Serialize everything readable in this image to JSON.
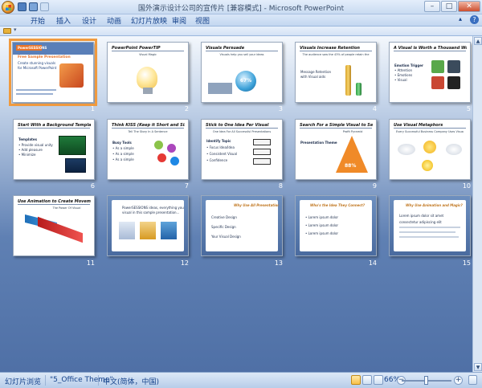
{
  "window": {
    "title": "国外演示设计公司的宣传片 [兼容模式] - Microsoft PowerPoint",
    "controls": [
      "–",
      "□",
      "✕"
    ]
  },
  "ribbon": {
    "tabs": [
      "开始",
      "插入",
      "设计",
      "动画",
      "幻灯片放映",
      "审阅",
      "视图"
    ]
  },
  "slides": [
    {
      "num": "1",
      "title": "PowerSESSIONS",
      "lines": [
        "Free Sample Presentation",
        "Create stunning visuals",
        "for Microsoft PowerPoint"
      ]
    },
    {
      "num": "2",
      "title": "PowerPoint PowerTIP",
      "sub": "Visual Magic",
      "lines": []
    },
    {
      "num": "3",
      "title": "Visuals Persuade",
      "sub": "Visuals help you sell your ideas",
      "lines": [
        "67%"
      ]
    },
    {
      "num": "4",
      "title": "Visuals Increase Retention",
      "sub": "The audience saw the 43% of people retain the",
      "lines": [
        "Message Retention",
        "with Visual aids"
      ]
    },
    {
      "num": "5",
      "title": "A Visual is Worth a Thousand Words",
      "lines": [
        "Emotion Trigger",
        "• Attention",
        "• Emotions",
        "• Visual"
      ]
    },
    {
      "num": "6",
      "title": "Start With a Background Template",
      "lines": [
        "Templates",
        "• Provide visual unity",
        "• Add pleasure",
        "• Minimize"
      ]
    },
    {
      "num": "7",
      "title": "Think KISS (Keep it Short and Simple)",
      "sub": "Tell The Story In A Sentence",
      "lines": [
        "Busy Tools",
        "• As a simple",
        "• As a simple",
        "• As a simple"
      ]
    },
    {
      "num": "8",
      "title": "Stick to One Idea Per Visual",
      "sub": "One Idea For All Successful Presentations",
      "lines": [
        "Identify Topic",
        "• Focus Idea/Idea",
        "• Consistent Visual",
        "• Confidence"
      ]
    },
    {
      "num": "9",
      "title": "Search For a Simple Visual to Sell your Message",
      "sub": "Profit Pyramid",
      "lines": [
        "Presentation Theme",
        "88%"
      ]
    },
    {
      "num": "10",
      "title": "Use Visual Metaphors",
      "sub": "Every Successful Business Company Uses Visual Metaphors",
      "lines": []
    },
    {
      "num": "11",
      "title": "Use Animation to Create Movement",
      "sub": "The Power Of Visual",
      "lines": []
    },
    {
      "num": "12",
      "title": "",
      "lines": [
        "PowerSESSIONS ideas, everything you",
        "visual in this sample presentation..."
      ]
    },
    {
      "num": "13",
      "title": "Why Use All Presentations?",
      "lines": [
        "Creative Design",
        "Specific Design",
        "Your Visual Design"
      ]
    },
    {
      "num": "14",
      "title": "Who's the Idea They Connect?",
      "lines": [
        "• Lorem ipsum dolor",
        "• Lorem ipsum dolor",
        "• Lorem ipsum dolor"
      ]
    },
    {
      "num": "15",
      "title": "Why Use Animation and Magic?",
      "lines": [
        "Lorem ipsum dolor sit amet",
        "consectetur adipiscing elit"
      ]
    }
  ],
  "statusbar": {
    "view": "幻灯片浏览",
    "theme": "\"5_Office Theme\"",
    "language": "中文(简体，中国)",
    "zoom": "66%",
    "zoom_minus": "−",
    "zoom_plus": "+"
  }
}
